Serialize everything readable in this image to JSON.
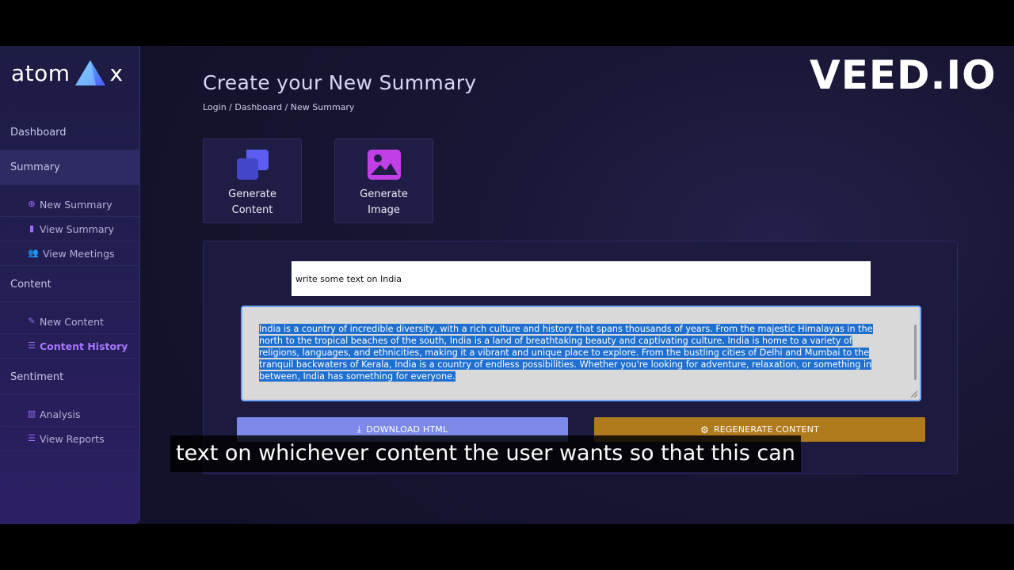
{
  "app": {
    "logo_left": "atom",
    "logo_right": "x",
    "watermark": "VEED.IO"
  },
  "sidebar": {
    "sections": [
      {
        "label": "Dashboard"
      },
      {
        "label": "Summary"
      },
      {
        "label": "Content"
      },
      {
        "label": "Sentiment"
      }
    ],
    "items": [
      {
        "label": "New Summary",
        "icon": "plus-circle-icon"
      },
      {
        "label": "View Summary",
        "icon": "book-icon"
      },
      {
        "label": "View Meetings",
        "icon": "users-icon"
      },
      {
        "label": "New Content",
        "icon": "pen-icon"
      },
      {
        "label": "Content History",
        "icon": "list-icon"
      },
      {
        "label": "Analysis",
        "icon": "bar-chart-icon"
      },
      {
        "label": "View Reports",
        "icon": "list-icon"
      }
    ]
  },
  "header": {
    "title": "Create your New Summary",
    "breadcrumb": [
      "Login",
      "Dashboard",
      "New Summary"
    ],
    "separator": " / "
  },
  "tools": [
    {
      "line1": "Generate",
      "line2": "Content",
      "icon": "copy-icon"
    },
    {
      "line1": "Generate",
      "line2": "Image",
      "icon": "image-icon"
    }
  ],
  "editor": {
    "prompt_value": "write some text on India",
    "output_text": "India is a country of incredible diversity, with a rich culture and history that spans thousands of years. From the majestic Himalayas in the north to the tropical beaches of the south, India is a land of breathtaking beauty and captivating culture. India is home to a variety of religions, languages, and ethnicities, making it a vibrant and unique place to explore. From the bustling cities of Delhi and Mumbai to the tranquil backwaters of Kerala, India is a country of endless possibilities. Whether you're looking for adventure, relaxation, or something in between, India has something for everyone.",
    "download_label": "DOWNLOAD HTML",
    "regenerate_label": "REGENERATE CONTENT"
  },
  "caption": "text on whichever content the user wants so that this can",
  "colors": {
    "accent": "#a877ff",
    "download_button": "#7c89e8",
    "regenerate_button": "#b07b1c",
    "selection": "#1e6fd0"
  }
}
